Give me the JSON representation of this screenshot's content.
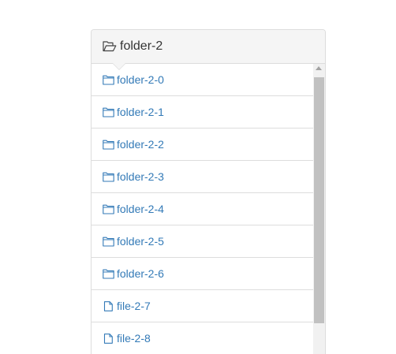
{
  "header": {
    "title": "folder-2",
    "icon": "folder-open-icon"
  },
  "items": [
    {
      "label": "folder-2-0",
      "type": "folder",
      "icon": "folder-icon"
    },
    {
      "label": "folder-2-1",
      "type": "folder",
      "icon": "folder-icon"
    },
    {
      "label": "folder-2-2",
      "type": "folder",
      "icon": "folder-icon"
    },
    {
      "label": "folder-2-3",
      "type": "folder",
      "icon": "folder-icon"
    },
    {
      "label": "folder-2-4",
      "type": "folder",
      "icon": "folder-icon"
    },
    {
      "label": "folder-2-5",
      "type": "folder",
      "icon": "folder-icon"
    },
    {
      "label": "folder-2-6",
      "type": "folder",
      "icon": "folder-icon"
    },
    {
      "label": "file-2-7",
      "type": "file",
      "icon": "file-icon"
    },
    {
      "label": "file-2-8",
      "type": "file",
      "icon": "file-icon"
    }
  ],
  "colors": {
    "link": "#337ab7",
    "heading_bg": "#f5f5f5",
    "border": "#dddddd"
  }
}
